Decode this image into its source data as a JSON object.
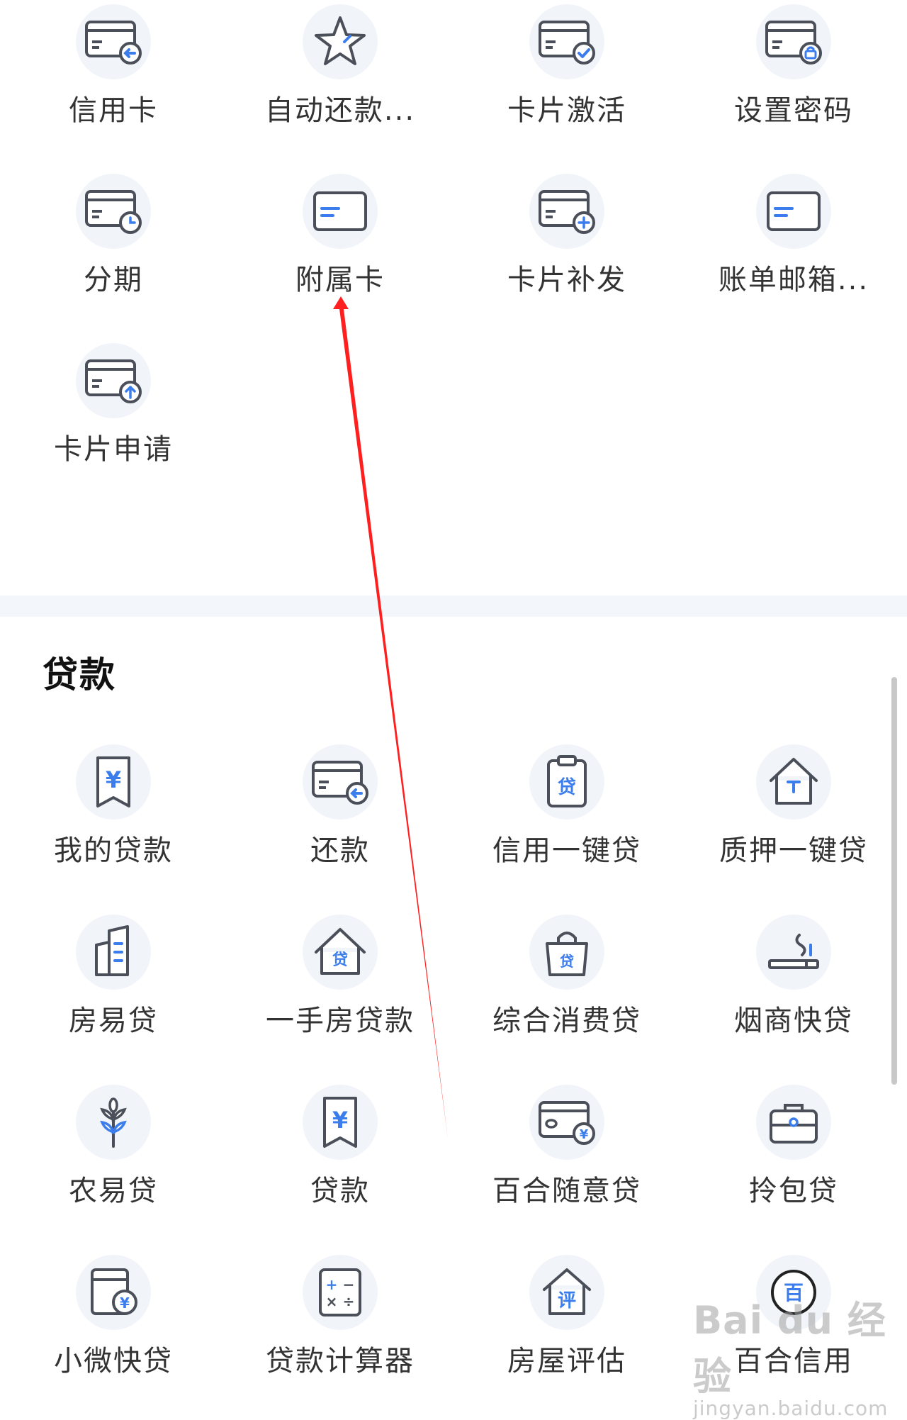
{
  "credit_card_services": [
    {
      "label": "信用卡",
      "icon": "card-return-icon"
    },
    {
      "label": "自动还款...",
      "icon": "star-icon"
    },
    {
      "label": "卡片激活",
      "icon": "card-check-icon"
    },
    {
      "label": "设置密码",
      "icon": "card-lock-icon"
    },
    {
      "label": "分期",
      "icon": "card-clock-icon"
    },
    {
      "label": "附属卡",
      "icon": "card-icon"
    },
    {
      "label": "卡片补发",
      "icon": "card-plus-icon"
    },
    {
      "label": "账单邮箱...",
      "icon": "card-icon"
    },
    {
      "label": "卡片申请",
      "icon": "card-upload-icon"
    }
  ],
  "loan_section": {
    "title": "贷款",
    "items": [
      {
        "label": "我的贷款",
        "icon": "yuan-bookmark-icon"
      },
      {
        "label": "还款",
        "icon": "card-return-icon"
      },
      {
        "label": "信用一键贷",
        "icon": "clipboard-loan-icon"
      },
      {
        "label": "质押一键贷",
        "icon": "house-pawn-icon"
      },
      {
        "label": "房易贷",
        "icon": "building-icon"
      },
      {
        "label": "一手房贷款",
        "icon": "house-loan-icon"
      },
      {
        "label": "综合消费贷",
        "icon": "shopping-bag-loan-icon"
      },
      {
        "label": "烟商快贷",
        "icon": "cigarette-icon"
      },
      {
        "label": "农易贷",
        "icon": "wheat-icon"
      },
      {
        "label": "贷款",
        "icon": "yuan-bookmark-icon"
      },
      {
        "label": "百合随意贷",
        "icon": "card-yuan-icon"
      },
      {
        "label": "拎包贷",
        "icon": "briefcase-icon"
      },
      {
        "label": "小微快贷",
        "icon": "document-yuan-icon"
      },
      {
        "label": "贷款计算器",
        "icon": "calculator-icon"
      },
      {
        "label": "房屋评估",
        "icon": "house-evaluate-icon"
      },
      {
        "label": "百合信用",
        "icon": "circle-bai-icon"
      }
    ]
  },
  "icon_text": {
    "loan_char": "贷",
    "yuan": "¥",
    "evaluate_char": "评",
    "bai_char": "百",
    "calc_plus": "+",
    "calc_minus": "−",
    "calc_times": "×",
    "calc_divide": "÷"
  },
  "watermark": {
    "logo": "Bai du 经验",
    "url": "jingyan.baidu.com"
  },
  "colors": {
    "icon_stroke": "#4a4f5a",
    "icon_accent": "#3b7ded",
    "icon_bg": "#f1f4f9",
    "annotation_arrow": "#ff1f1f"
  }
}
